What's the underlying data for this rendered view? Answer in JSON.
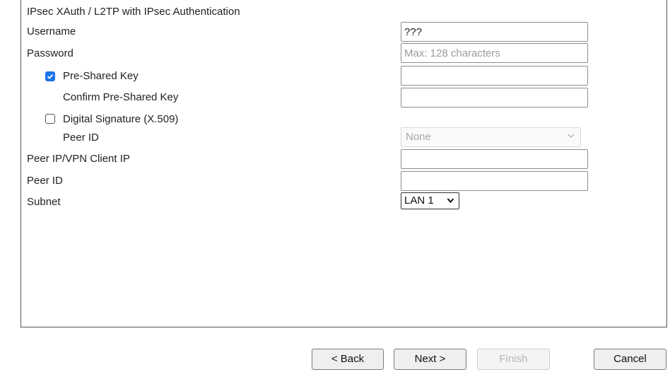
{
  "section": {
    "title": "IPsec XAuth / L2TP with IPsec Authentication"
  },
  "fields": {
    "username": {
      "label": "Username",
      "value": "???"
    },
    "password": {
      "label": "Password",
      "value": "",
      "placeholder": "Max: 128 characters"
    },
    "psk": {
      "label": "Pre-Shared Key",
      "checked": true,
      "value": ""
    },
    "confirm_psk": {
      "label": "Confirm Pre-Shared Key",
      "value": ""
    },
    "digital_signature": {
      "label": "Digital Signature (X.509)",
      "checked": false
    },
    "ds_peer_id": {
      "label": "Peer ID",
      "selected": "None"
    },
    "peer_ip": {
      "label": "Peer IP/VPN Client IP",
      "value": ""
    },
    "peer_id": {
      "label": "Peer ID",
      "value": ""
    },
    "subnet": {
      "label": "Subnet",
      "selected": "LAN 1"
    }
  },
  "buttons": {
    "back": "< Back",
    "next": "Next >",
    "finish": "Finish",
    "cancel": "Cancel"
  },
  "colors": {
    "checkbox_accent": "#1a73e8"
  }
}
